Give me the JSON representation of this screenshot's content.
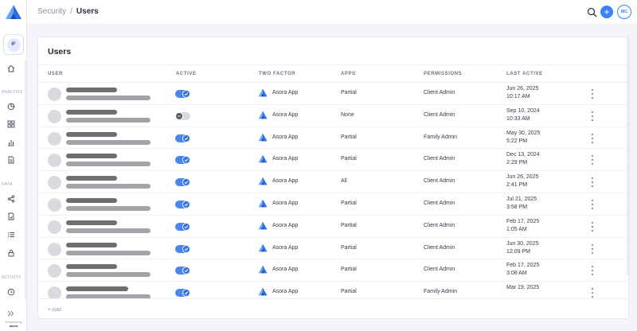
{
  "brand": {
    "logo_icon": "asora-logo-icon",
    "accent": "#3b82f6"
  },
  "sidebar": {
    "org_initials": "IF",
    "sections": [
      "ANALYSIS",
      "DATA",
      "ACTIVITY"
    ],
    "icons": [
      "home-icon",
      "pie-chart-icon",
      "grid-icon",
      "bar-chart-icon",
      "document-icon",
      "share-icon",
      "file-icon",
      "list-icon",
      "lock-icon",
      "clock-icon",
      "expand-icon"
    ],
    "powered_by": "Powered by",
    "powered_brand": "asora"
  },
  "topbar": {
    "breadcrumb_parent": "Security",
    "breadcrumb_sep": "/",
    "breadcrumb_current": "Users",
    "add_label": "+",
    "user_initials": "MC"
  },
  "panel": {
    "title": "Users",
    "columns": [
      "USER",
      "ACTIVE",
      "TWO FACTOR",
      "APPS",
      "PERMISSIONS",
      "LAST ACTIVE"
    ],
    "add_label": "+ Add"
  },
  "rows": [
    {
      "active": true,
      "two_factor": "Asora App",
      "apps": "Partial",
      "permissions": "Client Admin",
      "date": "Jun 26, 2025",
      "time": "10:17 AM"
    },
    {
      "active": false,
      "two_factor": "Asora App",
      "apps": "None",
      "permissions": "Client Admin",
      "date": "Sep 10, 2024",
      "time": "10:33 AM"
    },
    {
      "active": true,
      "two_factor": "Asora App",
      "apps": "Partial",
      "permissions": "Family Admin",
      "date": "May 30, 2025",
      "time": "5:22 PM"
    },
    {
      "active": true,
      "two_factor": "Asora App",
      "apps": "Partial",
      "permissions": "Client Admin",
      "date": "Dec 13, 2024",
      "time": "2:29 PM"
    },
    {
      "active": true,
      "two_factor": "Asora App",
      "apps": "All",
      "permissions": "Client Admin",
      "date": "Jun 26, 2025",
      "time": "2:41 PM"
    },
    {
      "active": true,
      "two_factor": "Asora App",
      "apps": "Partial",
      "permissions": "Client Admin",
      "date": "Jul 21, 2025",
      "time": "3:58 PM"
    },
    {
      "active": true,
      "two_factor": "Asora App",
      "apps": "Partial",
      "permissions": "Client Admin",
      "date": "Feb 17, 2025",
      "time": "1:05 AM"
    },
    {
      "active": true,
      "two_factor": "Asora App",
      "apps": "Partial",
      "permissions": "Client Admin",
      "date": "Jun 30, 2025",
      "time": "12:09 PM"
    },
    {
      "active": true,
      "two_factor": "Asora App",
      "apps": "Partial",
      "permissions": "Client Admin",
      "date": "Feb 17, 2025",
      "time": "3:08 AM"
    },
    {
      "active": true,
      "two_factor": "Asora App",
      "apps": "Partial",
      "permissions": "Family Admin",
      "date": "Mar 19, 2025",
      "time": ""
    }
  ]
}
